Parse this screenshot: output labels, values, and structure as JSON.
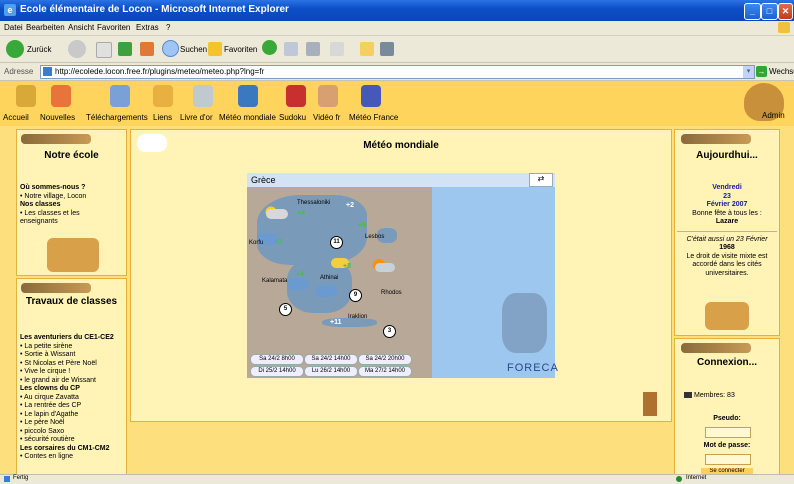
{
  "window": {
    "title": "Ecole élémentaire de Locon - Microsoft Internet Explorer"
  },
  "menu": [
    "Datei",
    "Bearbeiten",
    "Ansicht",
    "Favoriten",
    "Extras",
    "?"
  ],
  "toolbar": {
    "back": "Zurück",
    "search": "Suchen",
    "favorites": "Favoriten"
  },
  "address": {
    "label": "Adresse",
    "url": "http://ecolede.locon.free.fr/plugins/meteo/meteo.php?lng=fr",
    "go": "Wechseln zu",
    "links": "Links"
  },
  "nav": [
    "Accueil",
    "Nouvelles",
    "Téléchargements",
    "Liens",
    "Livre d'or",
    "Météo mondiale",
    "Sudoku",
    "Vidéo fr",
    "Météo France"
  ],
  "admin": "Admin",
  "left": {
    "box1": {
      "title": "Notre école",
      "items": [
        "Où sommes-nous ?",
        "• Notre village, Locon",
        "Nos classes",
        "• Les classes et les",
        "  enseignants"
      ]
    },
    "box2": {
      "title": "Travaux de classes",
      "items": [
        "Les aventuriers du CE1-CE2",
        "• La petite sirène",
        "• Sortie à Wissant",
        "• St Nicolas et Père Noël",
        "• Vive le cirque !",
        "• le grand air de Wissant",
        "Les clowns du CP",
        "• Au cirque Zavatta",
        "• La rentrée des CP",
        "• Le lapin d'Agathe",
        "• Le père Noël",
        "• piccolo Saxo",
        "• sécurité routière",
        "Les corsaires du CM1-CM2",
        "• Contes en ligne"
      ]
    }
  },
  "center": {
    "title": "Météo mondiale"
  },
  "map": {
    "region": "Grèce",
    "brand": "FORECA",
    "cities": [
      "Thessaloniki",
      "Korfu",
      "Lesbos",
      "Athinai",
      "Kalamata",
      "Rhodos",
      "Iraklion"
    ],
    "temps": [
      "+4",
      "+2",
      "+3",
      "+3",
      "+4",
      "+8",
      "+11"
    ],
    "winds": [
      "11",
      "9",
      "5",
      "3"
    ],
    "days": [
      "Sa 24/2 8h00",
      "Sa 24/2 14h00",
      "Sa 24/2 20h00",
      "Di 25/2 14h00",
      "Lu 26/2 14h00",
      "Ma 27/2 14h00"
    ]
  },
  "right": {
    "box1": {
      "title": "Aujourdhui...",
      "day": "Vendredi",
      "date": "23",
      "month": "Février 2007",
      "fete": "Bonne fête à tous les :",
      "name": "Lazare",
      "ago": "C'était aussi un 23 Février",
      "year": "1968",
      "fact1": "Le droit de visite mixte est",
      "fact2": "accordé dans les cités",
      "fact3": "universitaires."
    },
    "box2": {
      "title": "Connexion...",
      "members": "Membres: 83",
      "pseudo": "Pseudo:",
      "password": "Mot de passe:",
      "submit": "Se connecter"
    }
  },
  "status": {
    "left": "Fertig",
    "right": "Internet"
  }
}
